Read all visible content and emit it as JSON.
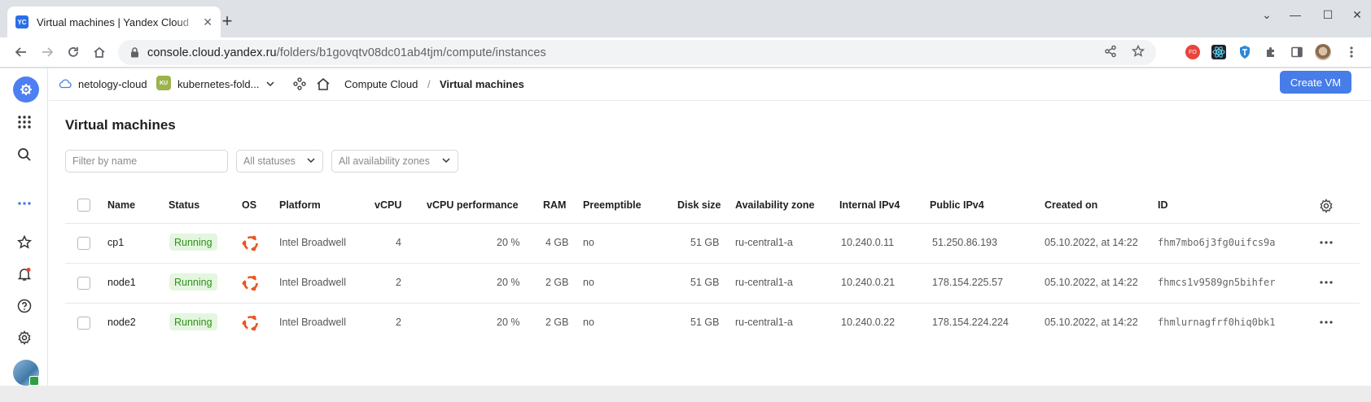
{
  "browser": {
    "tab_title": "Virtual machines | Yandex Cloud",
    "favicon_text": "YC",
    "url_host": "console.cloud.yandex.ru",
    "url_path": "/folders/b1govqtv08dc01ab4tjm/compute/instances",
    "extension_fo": "FO"
  },
  "header": {
    "cloud": "netology-cloud",
    "folder_badge": "KU",
    "folder": "kubernetes-fold...",
    "breadcrumb_service": "Compute Cloud",
    "breadcrumb_sep": "/",
    "breadcrumb_page": "Virtual machines",
    "create_button": "Create VM"
  },
  "main": {
    "title": "Virtual machines",
    "filter_placeholder": "Filter by name",
    "status_select": "All statuses",
    "zone_select": "All availability zones"
  },
  "table": {
    "columns": {
      "name": "Name",
      "status": "Status",
      "os": "OS",
      "platform": "Platform",
      "vcpu": "vCPU",
      "vcpu_perf": "vCPU performance",
      "ram": "RAM",
      "preemptible": "Preemptible",
      "disk": "Disk size",
      "zone": "Availability zone",
      "internal_ip": "Internal IPv4",
      "public_ip": "Public IPv4",
      "created": "Created on",
      "id": "ID"
    },
    "rows": [
      {
        "name": "cp1",
        "status": "Running",
        "platform": "Intel Broadwell",
        "vcpu": "4",
        "vcpu_perf": "20 %",
        "ram": "4 GB",
        "preemptible": "no",
        "disk": "51 GB",
        "zone": "ru-central1-a",
        "internal_ip": "10.240.0.11",
        "public_ip": "51.250.86.193",
        "created": "05.10.2022, at 14:22",
        "id": "fhm7mbo6j3fg0uifcs9a"
      },
      {
        "name": "node1",
        "status": "Running",
        "platform": "Intel Broadwell",
        "vcpu": "2",
        "vcpu_perf": "20 %",
        "ram": "2 GB",
        "preemptible": "no",
        "disk": "51 GB",
        "zone": "ru-central1-a",
        "internal_ip": "10.240.0.21",
        "public_ip": "178.154.225.57",
        "created": "05.10.2022, at 14:22",
        "id": "fhmcs1v9589gn5bihfer"
      },
      {
        "name": "node2",
        "status": "Running",
        "platform": "Intel Broadwell",
        "vcpu": "2",
        "vcpu_perf": "20 %",
        "ram": "2 GB",
        "preemptible": "no",
        "disk": "51 GB",
        "zone": "ru-central1-a",
        "internal_ip": "10.240.0.22",
        "public_ip": "178.154.224.224",
        "created": "05.10.2022, at 14:22",
        "id": "fhmlurnagfrf0hiq0bk1"
      }
    ]
  },
  "colors": {
    "accent": "#467de8",
    "status_running_bg": "#e4f6df",
    "status_running_text": "#2f8f1b",
    "ubuntu": "#e95420"
  }
}
